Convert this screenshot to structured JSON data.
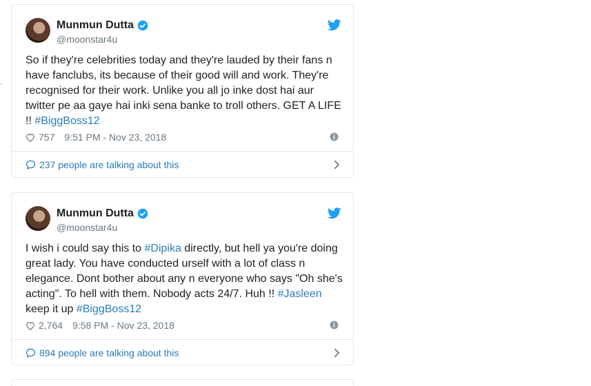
{
  "tweets": [
    {
      "name": "Munmun Dutta",
      "handle": "@moonstar4u",
      "text_parts": [
        "So if they're celebrities today and they're lauded by their fans n have fanclubs, its because of their good will and work. They're recognised for their work. Unlike you all jo inke dost hai aur twitter pe aa gaye hai inki sena banke to troll others. GET A LIFE !!  ",
        "#BiggBoss12"
      ],
      "likes": "757",
      "timestamp": "9:51 PM - Nov 23, 2018",
      "talking": "237 people are talking about this"
    },
    {
      "name": "Munmun Dutta",
      "handle": "@moonstar4u",
      "text_parts": [
        "I wish i could say this to ",
        "#Dipika",
        " directly,  but hell ya you're doing great lady. You have conducted urself with a lot of class n elegance. Dont bother about any n everyone who says \"Oh she's acting\". To hell with them. Nobody acts 24/7. Huh !! ",
        "#Jasleen",
        " keep it up ",
        "#BiggBoss12"
      ],
      "likes": "2,764",
      "timestamp": "9:58 PM - Nov 23, 2018",
      "talking": "894 people are talking about this"
    }
  ],
  "colors": {
    "link": "#2b7bb9",
    "muted": "#697882",
    "border": "#e1e8ed",
    "verified": "#1da1f2",
    "bird": "#1da1f2"
  },
  "icons": [
    "verified-badge-icon",
    "twitter-bird-icon",
    "heart-icon",
    "info-icon",
    "chat-bubble-icon",
    "chevron-right-icon"
  ]
}
